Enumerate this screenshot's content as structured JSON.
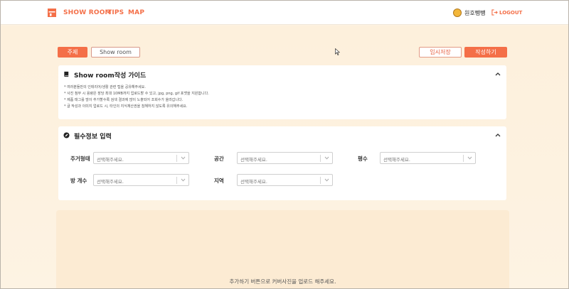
{
  "header": {
    "nav": {
      "showroom": "SHOW ROOM",
      "tips": "TIPS",
      "map": "MAP"
    },
    "user": {
      "name": "원호뺑뺑"
    },
    "logout_label": "LOGOUT"
  },
  "toolbar": {
    "tabs": [
      {
        "label": "주제",
        "active": true
      },
      {
        "label": "Show room",
        "active": false
      }
    ],
    "temp_save_label": "임시저장",
    "write_label": "작성하기"
  },
  "guide": {
    "title": "Show room작성 가이드",
    "items": [
      "* 여러분들만의 인테리어/생활 관련 팁을 공유해주세요.",
      "* 사진 첨부 시 용량은 장당 최대 10MB까지 업로드할 수 있고, jpg, png, gif 포맷을 지원합니다.",
      "* 제품 태그를 많이 추가할수록 검색 결과에 많이 노출되어 조회수가 올라갑니다.",
      "* 글 작성과 이미지 업로드 시, 타인의 지식재산권을 침해하지 않도록 유의해주세요."
    ]
  },
  "required": {
    "title": "필수정보 입력",
    "fields": {
      "housing_type": {
        "label": "주거형태",
        "placeholder": "선택해주세요."
      },
      "space": {
        "label": "공간",
        "placeholder": "선택해주세요."
      },
      "area": {
        "label": "평수",
        "placeholder": "선택해주세요."
      },
      "rooms": {
        "label": "방 개수",
        "placeholder": "선택해주세요."
      },
      "region": {
        "label": "지역",
        "placeholder": "선택해주세요."
      }
    }
  },
  "upload": {
    "hint": "추가하기 버튼으로 커버사진을 업로드 해주세요."
  },
  "colors": {
    "accent": "#f46f48",
    "page_bg": "#fdf3e3",
    "card_bg": "#ffffff",
    "upload_bg": "#fcebd3"
  },
  "icons": {
    "logo": "house-logo-icon",
    "avatar": "tiger-avatar-icon",
    "logout": "logout-icon",
    "guide": "book-icon",
    "required": "pencil-icon",
    "collapse": "chevron-up-icon",
    "select": "chevron-down-icon"
  }
}
